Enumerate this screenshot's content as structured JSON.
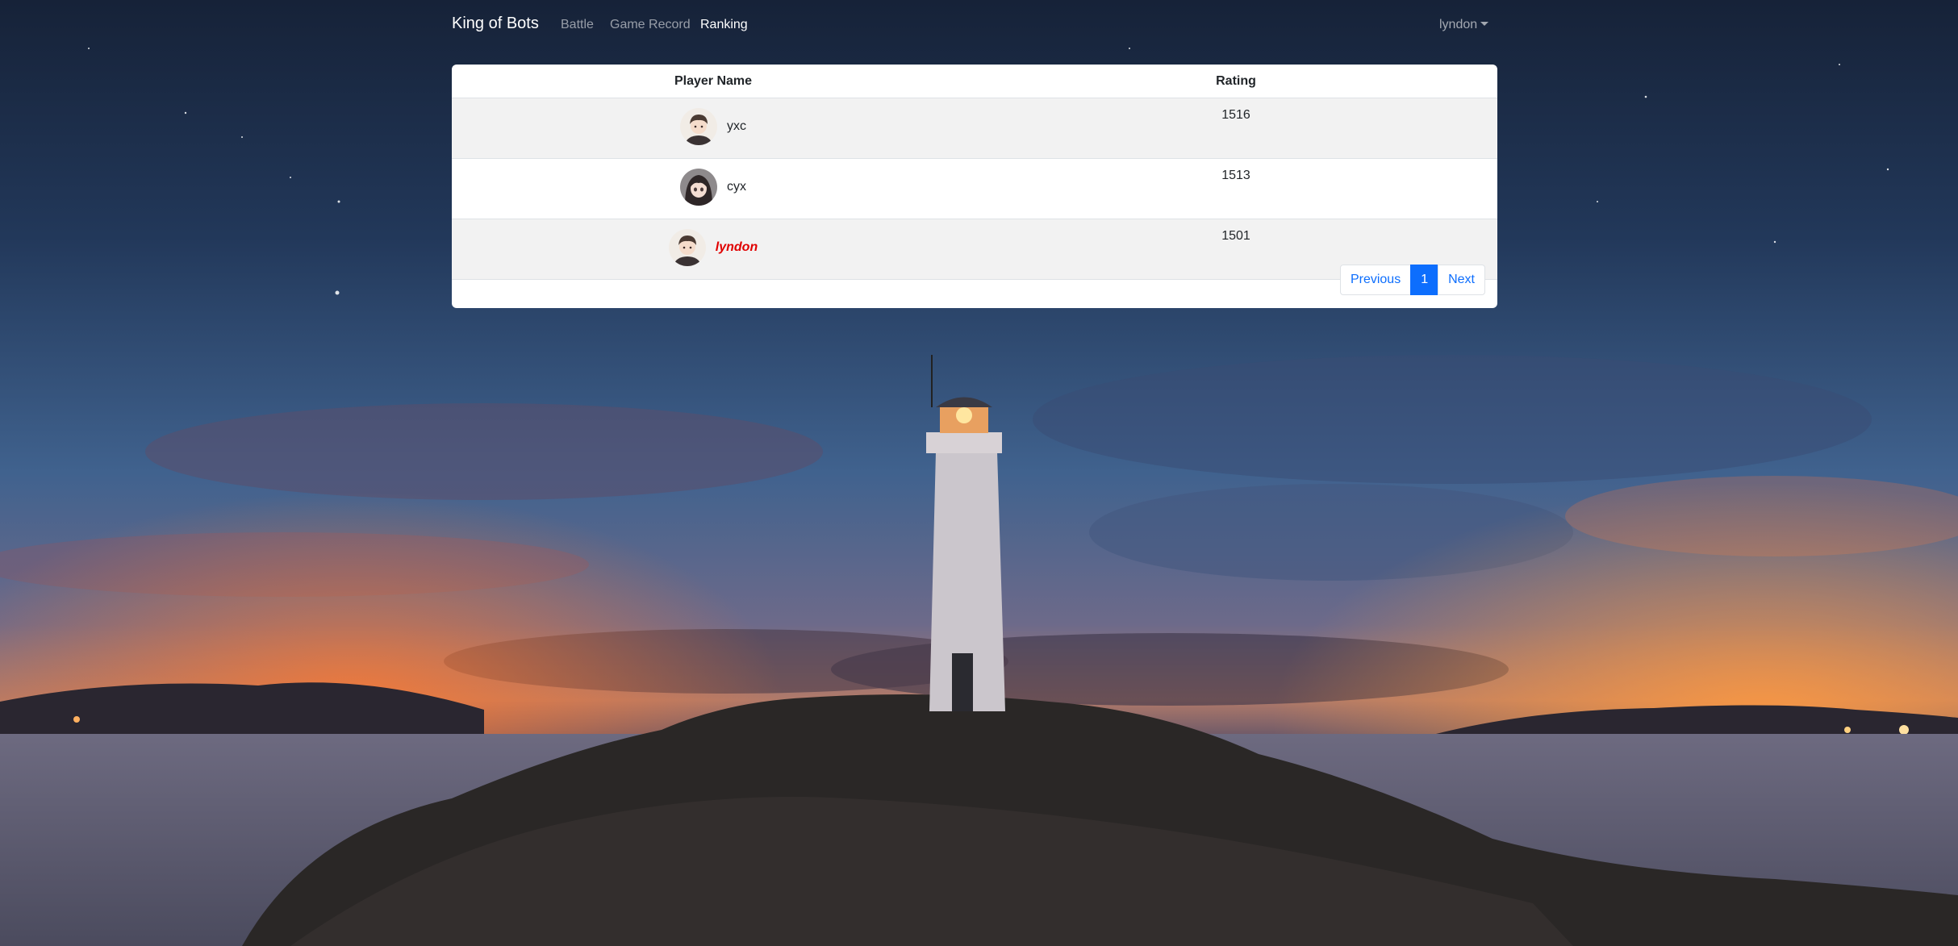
{
  "navbar": {
    "brand": "King of Bots",
    "links": [
      {
        "label": "Battle",
        "active": false
      },
      {
        "label": "Game Record",
        "active": false
      },
      {
        "label": "Ranking",
        "active": true
      }
    ],
    "user": "lyndon"
  },
  "table": {
    "columns": [
      "Player Name",
      "Rating"
    ],
    "rows": [
      {
        "name": "yxc",
        "rating": "1516",
        "avatar": "avatar-anime-boy",
        "highlight": false
      },
      {
        "name": "cyx",
        "rating": "1513",
        "avatar": "avatar-anime-girl",
        "highlight": false
      },
      {
        "name": "lyndon",
        "rating": "1501",
        "avatar": "avatar-anime-boy",
        "highlight": true
      }
    ]
  },
  "pagination": {
    "previous": "Previous",
    "pages": [
      "1"
    ],
    "current": "1",
    "next": "Next"
  },
  "colors": {
    "accent": "#0d6efd",
    "current_user": "#e00000"
  },
  "background": {
    "icon": "lighthouse-night-scene"
  }
}
